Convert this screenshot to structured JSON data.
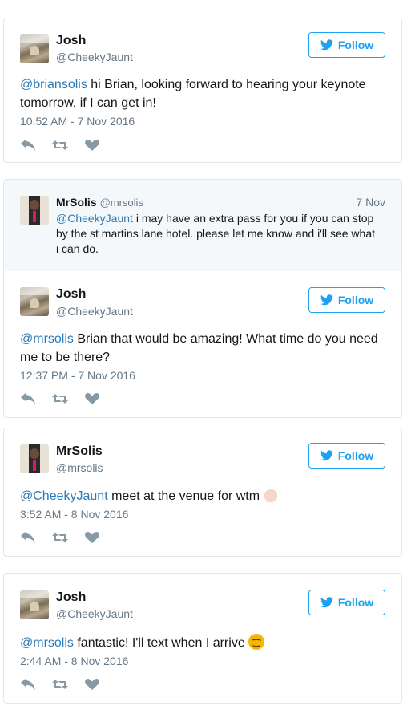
{
  "tweets": [
    {
      "name": "Josh",
      "handle": "@CheekyJaunt",
      "follow_label": "Follow",
      "mention": "@briansolis",
      "text": " hi Brian, looking forward to hearing your keynote tomorrow, if I can get in!",
      "time": "10:52 AM - 7 Nov 2016"
    },
    {
      "name": "Josh",
      "handle": "@CheekyJaunt",
      "follow_label": "Follow",
      "mention": "@mrsolis",
      "text": " Brian that would be amazing! What time do you need me to be there?",
      "time": "12:37 PM - 7 Nov 2016"
    },
    {
      "name": "MrSolis",
      "handle": "@mrsolis",
      "follow_label": "Follow",
      "mention": "@CheekyJaunt",
      "text": " meet at the venue for wtm",
      "time": "3:52 AM - 8 Nov 2016"
    },
    {
      "name": "Josh",
      "handle": "@CheekyJaunt",
      "follow_label": "Follow",
      "mention": "@mrsolis",
      "text": " fantastic! I'll text when I arrive",
      "time": "2:44 AM - 8 Nov 2016"
    }
  ],
  "quoted": {
    "name": "MrSolis",
    "handle": "@mrsolis",
    "date": "7 Nov",
    "mention": "@CheekyJaunt",
    "text": " i may have an extra pass for you if you can stop by the st martins lane hotel. please let me know and i'll see what i can do."
  },
  "icons": {
    "reply": "reply-icon",
    "retweet": "retweet-icon",
    "like": "heart-icon",
    "follow": "twitter-bird-icon"
  },
  "colors": {
    "link": "#2b7bb9",
    "accent": "#1da1f2",
    "muted": "#657786"
  }
}
